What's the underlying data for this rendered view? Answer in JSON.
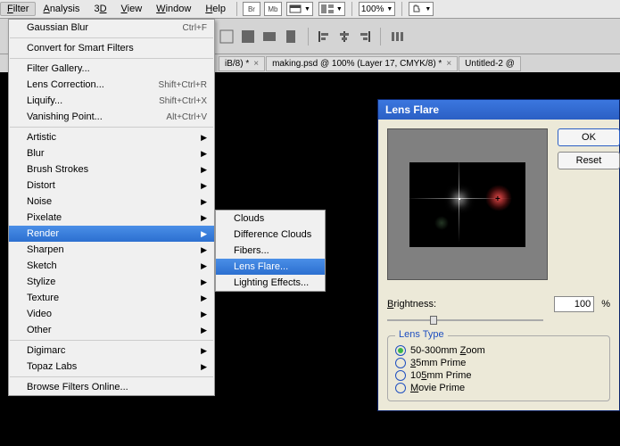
{
  "menubar": {
    "items": [
      "Filter",
      "Analysis",
      "3D",
      "View",
      "Window",
      "Help"
    ],
    "toolbar_icons": [
      "Br",
      "Mb"
    ],
    "zoom": "100%"
  },
  "tabs": [
    {
      "label": "iB/8) *"
    },
    {
      "label": "making.psd @ 100% (Layer 17, CMYK/8) *"
    },
    {
      "label": "Untitled-2 @"
    }
  ],
  "filter_menu": {
    "last": {
      "label": "Gaussian Blur",
      "shortcut": "Ctrl+F"
    },
    "smart": "Convert for Smart Filters",
    "group1": [
      {
        "label": "Filter Gallery..."
      },
      {
        "label": "Lens Correction...",
        "shortcut": "Shift+Ctrl+R"
      },
      {
        "label": "Liquify...",
        "shortcut": "Shift+Ctrl+X"
      },
      {
        "label": "Vanishing Point...",
        "shortcut": "Alt+Ctrl+V"
      }
    ],
    "group2": [
      "Artistic",
      "Blur",
      "Brush Strokes",
      "Distort",
      "Noise",
      "Pixelate",
      "Render",
      "Sharpen",
      "Sketch",
      "Stylize",
      "Texture",
      "Video",
      "Other"
    ],
    "group3": [
      "Digimarc",
      "Topaz Labs"
    ],
    "browse": "Browse Filters Online..."
  },
  "render_submenu": [
    "Clouds",
    "Difference Clouds",
    "Fibers...",
    "Lens Flare...",
    "Lighting Effects..."
  ],
  "dialog": {
    "title": "Lens Flare",
    "ok": "OK",
    "reset": "Reset",
    "brightness_label": "Brightness:",
    "brightness_value": "100",
    "percent": "%",
    "lenstype_label": "Lens Type",
    "options": [
      "50-300mm Zoom",
      "35mm Prime",
      "105mm Prime",
      "Movie Prime"
    ],
    "selected": 0
  }
}
